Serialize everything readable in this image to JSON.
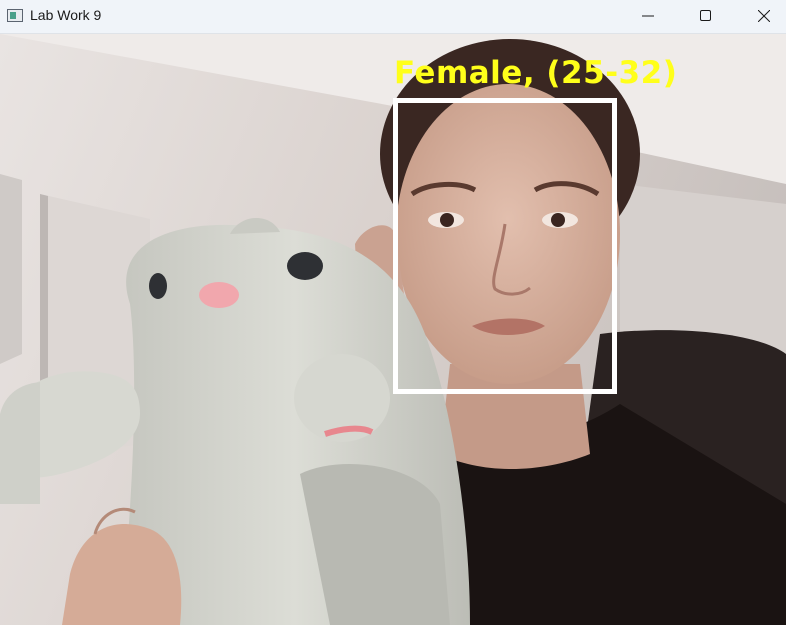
{
  "window": {
    "title": "Lab Work 9"
  },
  "controls": {
    "minimize_icon": "minimize-icon",
    "maximize_icon": "maximize-icon",
    "close_icon": "close-icon"
  },
  "detection": {
    "label": "Female, (25-32)",
    "box_color": "#ffffff",
    "label_color": "#ffff1a"
  }
}
